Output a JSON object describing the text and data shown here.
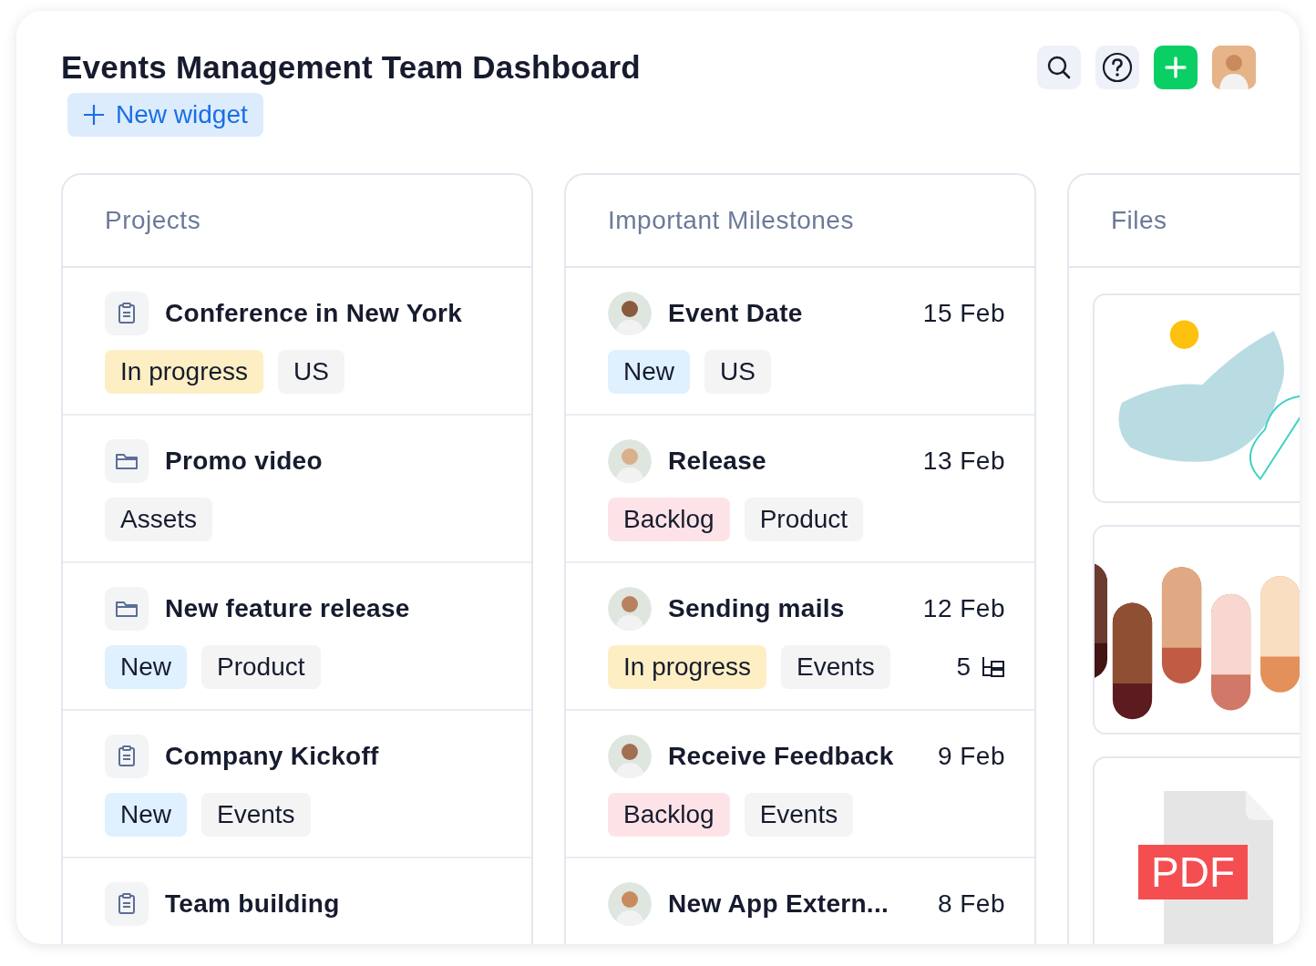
{
  "header": {
    "title": "Events Management Team Dashboard",
    "new_widget": "New widget"
  },
  "projects": {
    "title": "Projects",
    "items": [
      {
        "kind": "clipboard",
        "name": "Conference in New York",
        "tags": [
          {
            "label": "In progress",
            "color": "#fdefc3"
          },
          {
            "label": "US",
            "color": "#f4f4f5"
          }
        ]
      },
      {
        "kind": "folder",
        "name": "Promo video",
        "tags": [
          {
            "label": "Assets",
            "color": "#f4f4f5"
          }
        ]
      },
      {
        "kind": "folder",
        "name": "New feature release",
        "tags": [
          {
            "label": "New",
            "color": "#dff0fe"
          },
          {
            "label": "Product",
            "color": "#f4f4f5"
          }
        ]
      },
      {
        "kind": "clipboard",
        "name": "Company Kickoff",
        "tags": [
          {
            "label": "New",
            "color": "#dff0fe"
          },
          {
            "label": "Events",
            "color": "#f4f4f5"
          }
        ]
      },
      {
        "kind": "clipboard",
        "name": "Team building"
      }
    ]
  },
  "milestones": {
    "title": "Important Milestones",
    "items": [
      {
        "name": "Event Date",
        "date": "15 Feb",
        "tags": [
          {
            "label": "New",
            "color": "#dff0fe"
          },
          {
            "label": "US",
            "color": "#f4f4f5"
          }
        ]
      },
      {
        "name": "Release",
        "date": "13 Feb",
        "tags": [
          {
            "label": "Backlog",
            "color": "#fde3e7"
          },
          {
            "label": "Product",
            "color": "#f4f4f5"
          }
        ]
      },
      {
        "name": "Sending mails",
        "date": "12 Feb",
        "subtasks": "5",
        "tags": [
          {
            "label": "In progress",
            "color": "#fdefc3"
          },
          {
            "label": "Events",
            "color": "#f4f4f5"
          }
        ]
      },
      {
        "name": "Receive Feedback",
        "date": "9 Feb",
        "tags": [
          {
            "label": "Backlog",
            "color": "#fde3e7"
          },
          {
            "label": "Events",
            "color": "#f4f4f5"
          }
        ]
      },
      {
        "name": "New App Extern...",
        "date": "8 Feb"
      }
    ]
  },
  "files": {
    "title": "Files",
    "items": [
      {
        "kind": "picture"
      },
      {
        "kind": "picture"
      },
      {
        "kind": "document",
        "label": "PDF"
      }
    ]
  }
}
